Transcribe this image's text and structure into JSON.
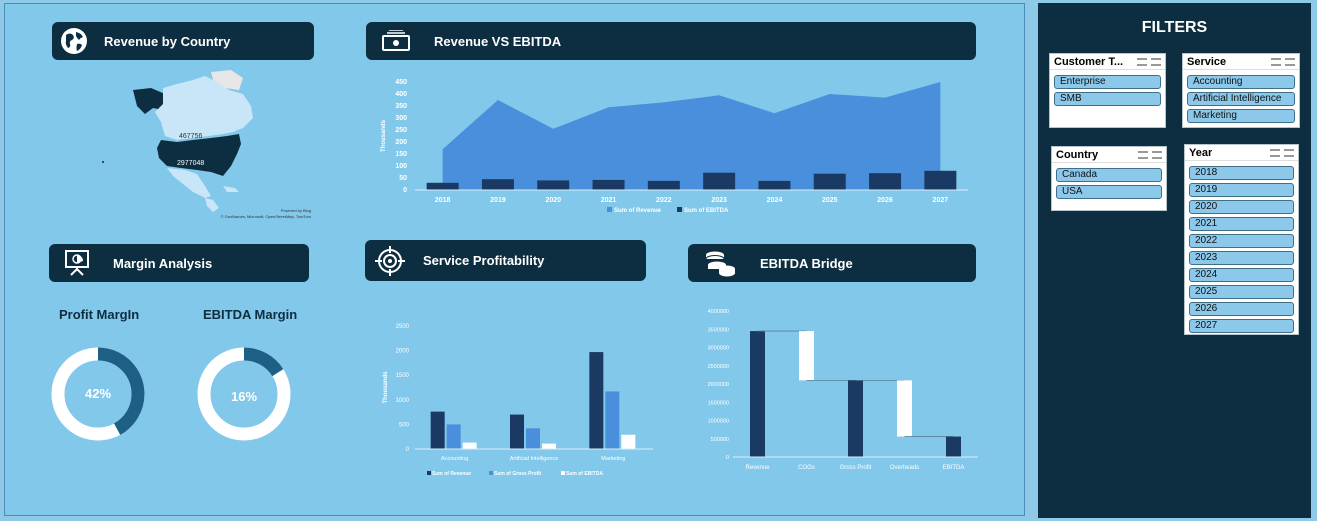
{
  "headers": {
    "revenue_by_country": "Revenue by Country",
    "revenue_vs_ebitda": "Revenue VS EBITDA",
    "margin_analysis": "Margin Analysis",
    "service_profitability": "Service Profitability",
    "ebitda_bridge": "EBITDA Bridge"
  },
  "map": {
    "canada_value": "467756",
    "usa_value": "2977048",
    "credit_line1": "Powered by Bing",
    "credit_line2": "© GeoNames, Microsoft, OpenStreetMap, TomTom"
  },
  "margins": {
    "profit_title": "Profit MargIn",
    "ebitda_title": "EBITDA Margin",
    "profit_value": "42%",
    "ebitda_value": "16%",
    "profit_fraction": 0.42,
    "ebitda_fraction": 0.16
  },
  "filters": {
    "title": "FILTERS",
    "customer_type": {
      "title": "Customer T...",
      "items": [
        "Enterprise",
        "SMB"
      ]
    },
    "service": {
      "title": "Service",
      "items": [
        "Accounting",
        "Artificial Intelligence",
        "Marketing"
      ]
    },
    "country": {
      "title": "Country",
      "items": [
        "Canada",
        "USA"
      ]
    },
    "year": {
      "title": "Year",
      "items": [
        "2018",
        "2019",
        "2020",
        "2021",
        "2022",
        "2023",
        "2024",
        "2025",
        "2026",
        "2027"
      ]
    }
  },
  "colors": {
    "dark_navy": "#0d2d40",
    "series_dark": "#1b3a63",
    "series_mid": "#4a8fdc",
    "background": "#82c8ea"
  },
  "chart_data": [
    {
      "type": "area",
      "ylabel": "Thousands",
      "ylim": [
        0,
        450
      ],
      "yticks": [
        "450",
        "400",
        "350",
        "300",
        "250",
        "200",
        "150",
        "100",
        "50",
        "0"
      ],
      "categories": [
        "2018",
        "2019",
        "2020",
        "2021",
        "2022",
        "2023",
        "2024",
        "2025",
        "2026",
        "2027"
      ],
      "series": [
        {
          "name": "Sum of Revenue",
          "values": [
            170,
            375,
            255,
            345,
            365,
            395,
            320,
            400,
            385,
            450
          ]
        },
        {
          "name": "Sum of EBITDA",
          "values": [
            30,
            45,
            40,
            42,
            38,
            72,
            38,
            68,
            70,
            80
          ]
        }
      ]
    },
    {
      "type": "bar",
      "ylabel": "Thousands",
      "ylim": [
        0,
        2500
      ],
      "yticks": [
        "2500",
        "2000",
        "1500",
        "1000",
        "500",
        "0"
      ],
      "categories": [
        "Accounting",
        "Artificial Intelligence",
        "Marketing"
      ],
      "series": [
        {
          "name": "Sum of Revenue",
          "values": [
            760,
            700,
            1970
          ]
        },
        {
          "name": "Sum of Gross Profit",
          "values": [
            500,
            420,
            1170
          ]
        },
        {
          "name": "Sum of EBITDA",
          "values": [
            130,
            110,
            290
          ]
        }
      ]
    },
    {
      "type": "bar",
      "ylim": [
        0,
        4000000
      ],
      "yticks": [
        "4000000",
        "3500000",
        "3000000",
        "2500000",
        "2000000",
        "1500000",
        "1000000",
        "500000",
        "0"
      ],
      "categories": [
        "Revenue",
        "COGs",
        "Gross Profit",
        "Overheads",
        "EBITDA"
      ],
      "bars": [
        {
          "base": 0,
          "top": 3450000,
          "kind": "total"
        },
        {
          "base": 2100000,
          "top": 3450000,
          "kind": "decrease"
        },
        {
          "base": 0,
          "top": 2100000,
          "kind": "total"
        },
        {
          "base": 560000,
          "top": 2100000,
          "kind": "decrease"
        },
        {
          "base": 0,
          "top": 560000,
          "kind": "total"
        }
      ]
    }
  ]
}
